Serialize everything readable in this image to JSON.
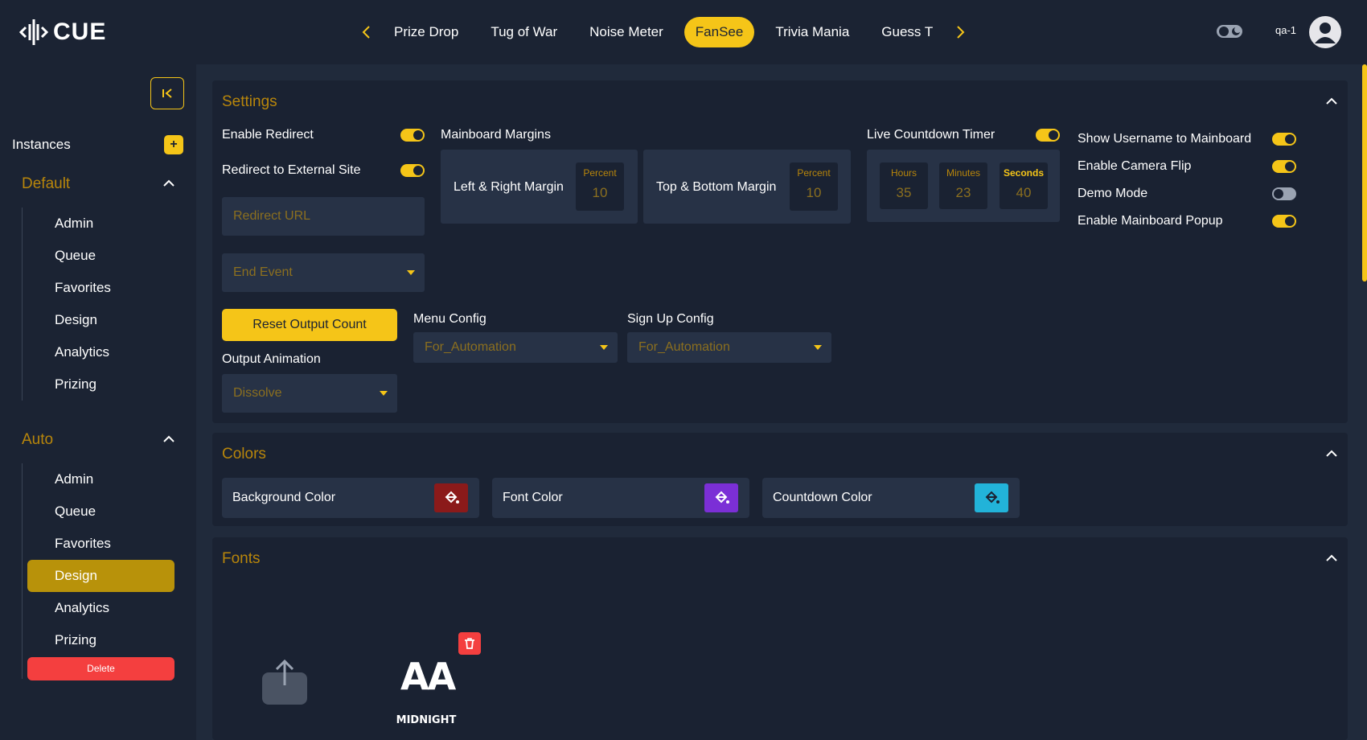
{
  "header": {
    "logo_text": "CUE",
    "tabs": [
      "Prize Drop",
      "Tug of War",
      "Noise Meter",
      "FanSee",
      "Trivia Mania",
      "Guess T"
    ],
    "active_tab": "FanSee",
    "user": "qa-1"
  },
  "sidebar": {
    "instances_label": "Instances",
    "add_label": "+",
    "groups": [
      {
        "title": "Default",
        "items": [
          "Admin",
          "Queue",
          "Favorites",
          "Design",
          "Analytics",
          "Prizing"
        ]
      },
      {
        "title": "Auto",
        "items": [
          "Admin",
          "Queue",
          "Favorites",
          "Design",
          "Analytics",
          "Prizing"
        ]
      }
    ],
    "active_item": "Auto/Design",
    "delete_label": "Delete"
  },
  "settings": {
    "title": "Settings",
    "enable_redirect": "Enable Redirect",
    "redirect_external": "Redirect to External Site",
    "redirect_url_placeholder": "Redirect URL",
    "end_event_placeholder": "End Event",
    "mainboard_margins": "Mainboard Margins",
    "left_right_margin": "Left & Right Margin",
    "top_bottom_margin": "Top & Bottom Margin",
    "percent_label": "Percent",
    "left_right_value": "10",
    "top_bottom_value": "10",
    "live_countdown": "Live Countdown Timer",
    "hours_label": "Hours",
    "minutes_label": "Minutes",
    "seconds_label": "Seconds",
    "hours_value": "35",
    "minutes_value": "23",
    "seconds_value": "40",
    "show_username": "Show Username to Mainboard",
    "enable_camera_flip": "Enable Camera Flip",
    "demo_mode": "Demo Mode",
    "enable_popup": "Enable Mainboard Popup",
    "reset_output": "Reset Output Count",
    "output_animation": "Output Animation",
    "output_animation_value": "Dissolve",
    "menu_config": "Menu Config",
    "menu_config_value": "For_Automation",
    "signup_config": "Sign Up Config",
    "signup_config_value": "For_Automation",
    "toggles": {
      "enable_redirect": true,
      "redirect_external": true,
      "live_countdown": true,
      "show_username": true,
      "camera_flip": true,
      "demo_mode": false,
      "popup": true
    }
  },
  "colors": {
    "title": "Colors",
    "background": "Background Color",
    "font": "Font Color",
    "countdown": "Countdown Color",
    "background_hex": "#8b1a1a",
    "font_hex": "#7b2fd6",
    "countdown_hex": "#22b3d9",
    "accent": "#f5c518"
  },
  "fonts": {
    "title": "Fonts",
    "font_preview": "AA",
    "font_name": "MIDNIGHT"
  }
}
